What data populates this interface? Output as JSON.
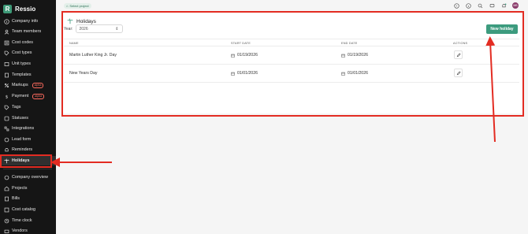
{
  "brand": {
    "name": "Ressio",
    "logo_letter": "R"
  },
  "sidebar": {
    "items": [
      {
        "label": "Company info",
        "icon": "info-icon"
      },
      {
        "label": "Team members",
        "icon": "team-icon"
      },
      {
        "label": "Cost codes",
        "icon": "cost-codes-icon"
      },
      {
        "label": "Cost types",
        "icon": "tag-icon"
      },
      {
        "label": "Unit types",
        "icon": "unit-icon"
      },
      {
        "label": "Templates",
        "icon": "template-icon"
      },
      {
        "label": "Markups",
        "icon": "markup-icon",
        "badge": "alpha"
      },
      {
        "label": "Payment",
        "icon": "dollar-icon",
        "badge": "alpha"
      },
      {
        "label": "Tags",
        "icon": "tag-icon"
      },
      {
        "label": "Statuses",
        "icon": "status-icon"
      },
      {
        "label": "Integrations",
        "icon": "integrations-icon"
      },
      {
        "label": "Lead form",
        "icon": "lead-form-icon"
      },
      {
        "label": "Reminders",
        "icon": "bell-icon"
      },
      {
        "label": "Holidays",
        "icon": "palm-tree-icon"
      },
      {
        "label": "Company overview",
        "icon": "overview-icon"
      },
      {
        "label": "Projects",
        "icon": "projects-icon"
      },
      {
        "label": "Bills",
        "icon": "bills-icon"
      },
      {
        "label": "Cost catalog",
        "icon": "catalog-icon"
      },
      {
        "label": "Time clock",
        "icon": "clock-icon"
      },
      {
        "label": "Vendors",
        "icon": "vendors-icon"
      }
    ],
    "active": "Holidays"
  },
  "topbar": {
    "project_chip": "Select project",
    "icons": [
      "help-icon",
      "info-icon",
      "search-icon",
      "chat-icon",
      "notifications-icon"
    ],
    "avatar_initials": "MB"
  },
  "page": {
    "title": "Holidays",
    "year_label": "Year:",
    "year_value": "2026",
    "new_button": "New holiday"
  },
  "table": {
    "columns": [
      "NAME",
      "START DATE",
      "END DATE",
      "ACTIONS"
    ],
    "rows": [
      {
        "name": "Martin Luther King Jr. Day",
        "start": "01/19/2026",
        "end": "01/19/2026"
      },
      {
        "name": "New Years Day",
        "start": "01/01/2026",
        "end": "01/01/2026"
      }
    ]
  },
  "colors": {
    "accent": "#3c9b7e",
    "annotation": "#e32c22",
    "sidebar": "#151515"
  }
}
